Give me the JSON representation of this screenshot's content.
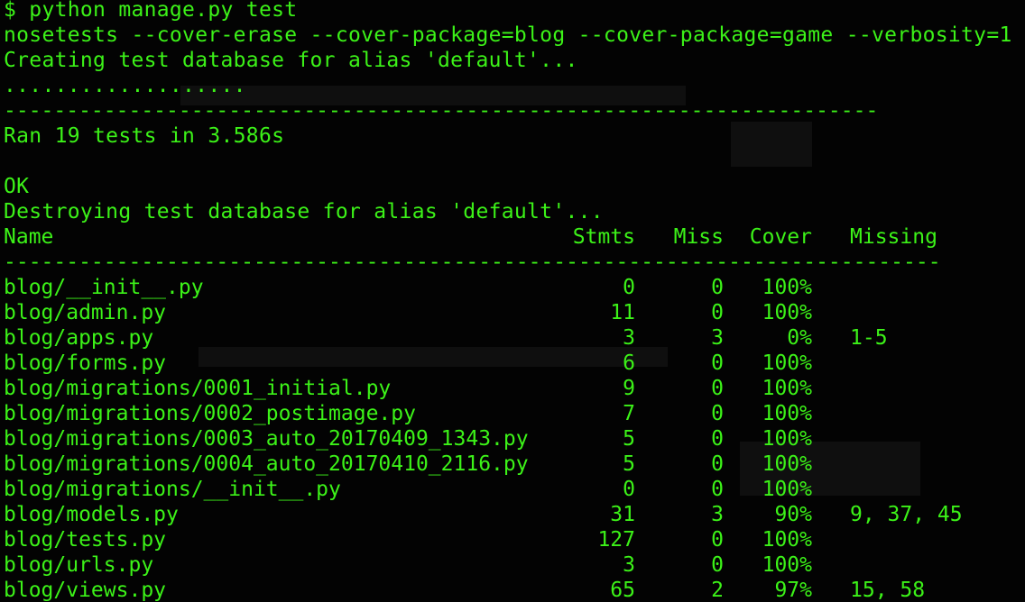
{
  "terminal": {
    "text_color": "#3cf218",
    "background": "#030303",
    "lines": {
      "command": "$ python manage.py test",
      "nose": "nosetests --cover-erase --cover-package=blog --cover-package=game --verbosity=1",
      "creating": "Creating test database for alias 'default'...",
      "dots": "...................",
      "sep1": "----------------------------------------------------------------------",
      "ran": "Ran 19 tests in 3.586s",
      "ok": "OK",
      "destroying": "Destroying test database for alias 'default'...",
      "sep2": "---------------------------------------------------------------------------"
    },
    "coverage": {
      "headers": {
        "name": "Name",
        "stmts": "Stmts",
        "miss": "Miss",
        "cover": "Cover",
        "missing": "Missing"
      },
      "rows": [
        {
          "name": "blog/__init__.py",
          "stmts": "0",
          "miss": "0",
          "cover": "100%",
          "missing": ""
        },
        {
          "name": "blog/admin.py",
          "stmts": "11",
          "miss": "0",
          "cover": "100%",
          "missing": ""
        },
        {
          "name": "blog/apps.py",
          "stmts": "3",
          "miss": "3",
          "cover": "0%",
          "missing": "1-5"
        },
        {
          "name": "blog/forms.py",
          "stmts": "6",
          "miss": "0",
          "cover": "100%",
          "missing": ""
        },
        {
          "name": "blog/migrations/0001_initial.py",
          "stmts": "9",
          "miss": "0",
          "cover": "100%",
          "missing": ""
        },
        {
          "name": "blog/migrations/0002_postimage.py",
          "stmts": "7",
          "miss": "0",
          "cover": "100%",
          "missing": ""
        },
        {
          "name": "blog/migrations/0003_auto_20170409_1343.py",
          "stmts": "5",
          "miss": "0",
          "cover": "100%",
          "missing": ""
        },
        {
          "name": "blog/migrations/0004_auto_20170410_2116.py",
          "stmts": "5",
          "miss": "0",
          "cover": "100%",
          "missing": ""
        },
        {
          "name": "blog/migrations/__init__.py",
          "stmts": "0",
          "miss": "0",
          "cover": "100%",
          "missing": ""
        },
        {
          "name": "blog/models.py",
          "stmts": "31",
          "miss": "3",
          "cover": "90%",
          "missing": "9, 37, 45"
        },
        {
          "name": "blog/tests.py",
          "stmts": "127",
          "miss": "0",
          "cover": "100%",
          "missing": ""
        },
        {
          "name": "blog/urls.py",
          "stmts": "3",
          "miss": "0",
          "cover": "100%",
          "missing": ""
        },
        {
          "name": "blog/views.py",
          "stmts": "65",
          "miss": "2",
          "cover": "97%",
          "missing": "15, 58"
        }
      ]
    }
  }
}
